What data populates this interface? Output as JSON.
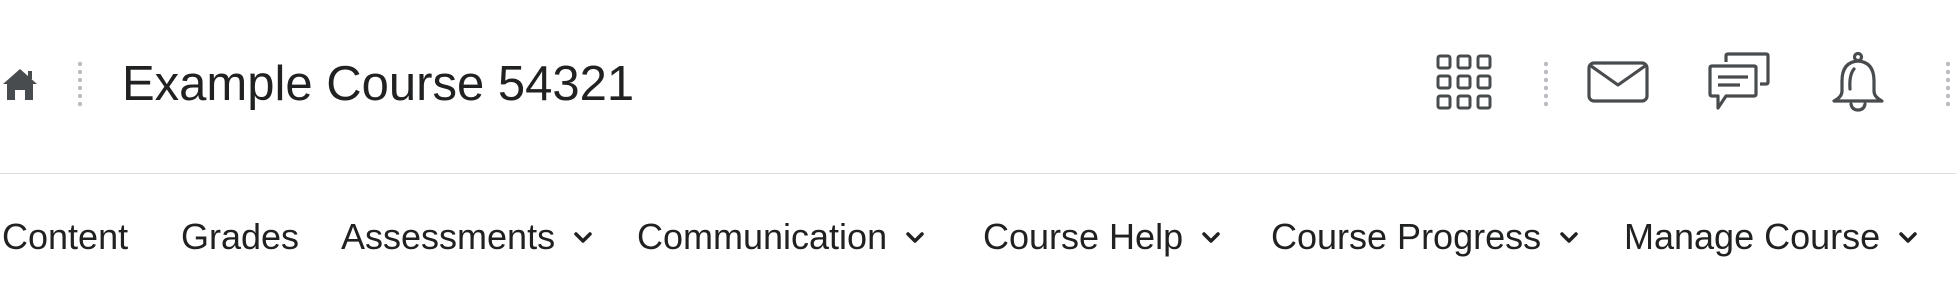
{
  "header": {
    "home_icon": "home-icon",
    "course_title": "Example Course 54321",
    "icons": [
      "course-selector-grid-icon",
      "email-icon",
      "chat-icon",
      "notification-bell-icon"
    ]
  },
  "nav": {
    "items": [
      {
        "label": "Content",
        "has_dropdown": false
      },
      {
        "label": "Grades",
        "has_dropdown": false
      },
      {
        "label": "Assessments",
        "has_dropdown": true
      },
      {
        "label": "Communication",
        "has_dropdown": true
      },
      {
        "label": "Course Help",
        "has_dropdown": true
      },
      {
        "label": "Course Progress",
        "has_dropdown": true
      },
      {
        "label": "Manage Course",
        "has_dropdown": true
      }
    ]
  },
  "colors": {
    "text": "#202122",
    "icon": "#494c4e",
    "separator": "#dcdfe2"
  }
}
